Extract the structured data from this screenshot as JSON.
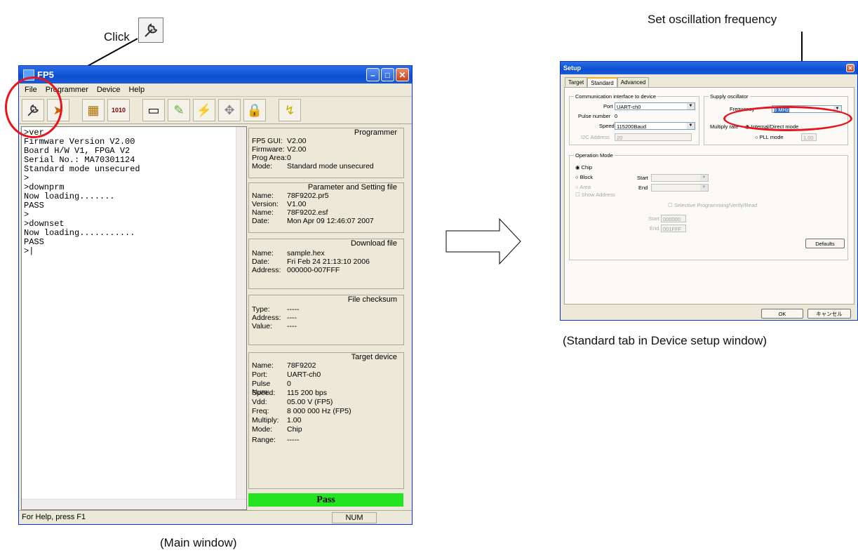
{
  "annotations": {
    "click_label": "Click",
    "set_osc_label": "Set oscillation frequency",
    "main_caption": "(Main window)",
    "setup_caption": "(Standard tab in Device setup window)"
  },
  "main_window": {
    "title": "FP5",
    "menu": [
      "File",
      "Programmer",
      "Device",
      "Help"
    ],
    "toolbar_icons": [
      "setup-wrench-icon",
      "open-parameter-file-icon",
      "chip-icon",
      "hex-load-icon",
      "blank-check-icon",
      "erase-icon",
      "program-icon",
      "verify-icon",
      "security-icon",
      "autoprocedure-icon"
    ],
    "console_lines": [
      ">ver",
      "Firmware Version V2.00",
      "Board H/W V1, FPGA V2",
      "Serial No.: MA70301124",
      "Standard mode unsecured",
      ">",
      ">downprm",
      "Now loading.......",
      "PASS",
      ">",
      ">downset",
      "Now loading...........",
      "PASS",
      ">|"
    ],
    "programmer": {
      "title": "Programmer",
      "rows": [
        [
          "FP5 GUI:",
          "V2.00"
        ],
        [
          "Firmware:",
          "V2.00"
        ],
        [
          "Prog Area:",
          "0"
        ],
        [
          "Mode:",
          "Standard mode unsecured"
        ]
      ]
    },
    "param_file": {
      "title": "Parameter and Setting file",
      "rows": [
        [
          "Name:",
          "78F9202.pr5"
        ],
        [
          "Version:",
          "V1.00"
        ],
        [
          "Name:",
          "78F9202.esf"
        ],
        [
          "Date:",
          "Mon Apr 09 12:46:07 2007"
        ]
      ]
    },
    "download_file": {
      "title": "Download file",
      "rows": [
        [
          "Name:",
          "sample.hex"
        ],
        [
          "Date:",
          "Fri Feb 24 21:13:10 2006"
        ],
        [
          "Address:",
          "000000-007FFF"
        ]
      ]
    },
    "checksum": {
      "title": "File checksum",
      "rows": [
        [
          "Type:",
          "-----"
        ],
        [
          "Address:",
          "----"
        ],
        [
          "Value:",
          "----"
        ]
      ]
    },
    "target": {
      "title": "Target device",
      "rows": [
        [
          "Name:",
          "78F9202"
        ],
        [
          "Port:",
          "UART-ch0"
        ],
        [
          "Pulse Num:",
          "0"
        ],
        [
          "Speed:",
          "115 200 bps"
        ],
        [
          "Vdd:",
          "05.00 V (FP5)"
        ],
        [
          "Freq:",
          "8 000 000 Hz (FP5)"
        ],
        [
          "Multiply:",
          "1.00"
        ],
        [
          "Mode:",
          "Chip"
        ],
        [
          "Range:",
          "-----"
        ]
      ]
    },
    "pass_label": "Pass",
    "status_text": "For Help, press F1",
    "status_num": "NUM"
  },
  "setup_window": {
    "title": "Setup",
    "tabs": [
      "Target",
      "Standard",
      "Advanced"
    ],
    "comm_group": "Communication interface to device",
    "port_label": "Port",
    "port_value": "UART-ch0",
    "pulse_label": "Pulse number",
    "pulse_value": "0",
    "speed_label": "Speed",
    "speed_value": "115200Baud",
    "i2c_label": "I2C Address",
    "i2c_value": "20",
    "osc_group": "Supply oscillator",
    "freq_label": "Frequency",
    "freq_value": "8 MHz",
    "multiply_label": "Multiply rate",
    "internal_label": "Internal/Direct mode",
    "pll_label": "PLL mode",
    "pll_value": "1.00",
    "op_group": "Operation Mode",
    "chip_label": "Chip",
    "block_label": "Block",
    "area_label": "Area",
    "show_addr_label": "Show Address",
    "start_label": "Start",
    "end_label": "End",
    "selective_label": "Selective Programming/Verify/Read",
    "start2_label": "Start",
    "start2_value": "000000",
    "end2_label": "End",
    "end2_value": "001FFF",
    "defaults_label": "Defaults",
    "ok_label": "OK",
    "cancel_label": "キャンセル"
  }
}
